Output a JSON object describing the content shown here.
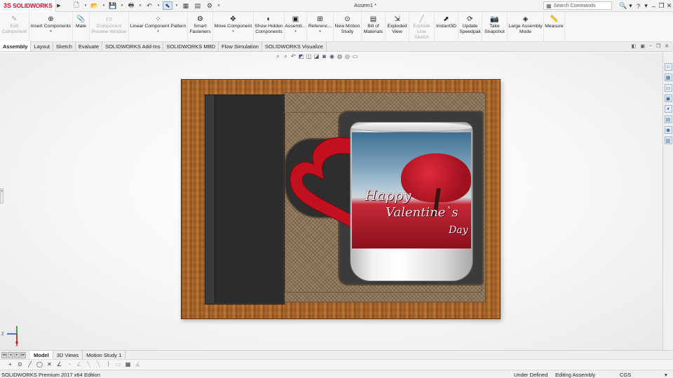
{
  "app": {
    "brand_prefix": "3S",
    "brand_name": "SOLIDWORKS",
    "document_title": "Assem1 *",
    "search_placeholder": "Search Commands"
  },
  "quick_access": [
    "new-icon",
    "open-icon",
    "save-icon",
    "print-icon",
    "undo-icon",
    "select-icon",
    "rebuild-icon",
    "file-properties-icon",
    "options-icon"
  ],
  "command_manager": [
    {
      "label": "Edit\nComponent",
      "enabled": false,
      "icon": "✎",
      "dropdown": false
    },
    {
      "label": "Insert Components",
      "enabled": true,
      "icon": "⊕",
      "dropdown": true
    },
    {
      "label": "Mate",
      "enabled": true,
      "icon": "📎",
      "dropdown": false
    },
    {
      "label": "Component\nPreview Window",
      "enabled": false,
      "icon": "▭",
      "dropdown": false
    },
    {
      "label": "Linear Component Pattern",
      "enabled": true,
      "icon": "⁘",
      "dropdown": true
    },
    {
      "label": "Smart\nFasteners",
      "enabled": true,
      "icon": "⚙",
      "dropdown": false
    },
    {
      "label": "Move Component",
      "enabled": true,
      "icon": "✥",
      "dropdown": true
    },
    {
      "label": "Show Hidden\nComponents",
      "enabled": true,
      "icon": "◐",
      "dropdown": false
    },
    {
      "label": "Assemb...",
      "enabled": true,
      "icon": "▣",
      "dropdown": true
    },
    {
      "label": "Referenc...",
      "enabled": true,
      "icon": "⊞",
      "dropdown": true
    },
    {
      "label": "New Motion\nStudy",
      "enabled": true,
      "icon": "⊙",
      "dropdown": false
    },
    {
      "label": "Bill of\nMaterials",
      "enabled": true,
      "icon": "▤",
      "dropdown": false
    },
    {
      "label": "Exploded\nView",
      "enabled": true,
      "icon": "⇲",
      "dropdown": false
    },
    {
      "label": "Explode\nLine Sketch",
      "enabled": false,
      "icon": "╱",
      "dropdown": false
    },
    {
      "label": "Instant3D",
      "enabled": true,
      "icon": "⬈",
      "dropdown": false
    },
    {
      "label": "Update\nSpeedpak",
      "enabled": true,
      "icon": "⟳",
      "dropdown": false
    },
    {
      "label": "Take\nSnapshot",
      "enabled": true,
      "icon": "📷",
      "dropdown": false
    },
    {
      "label": "Large Assembly\nMode",
      "enabled": true,
      "icon": "◈",
      "dropdown": false
    },
    {
      "label": "Measure",
      "enabled": true,
      "icon": "📏",
      "dropdown": false
    }
  ],
  "tabs": [
    "Assembly",
    "Layout",
    "Sketch",
    "Evaluate",
    "SOLIDWORKS Add-Ins",
    "SOLIDWORKS MBD",
    "Flow Simulation",
    "SOLIDWORKS Visualize"
  ],
  "active_tab": "Assembly",
  "mug": {
    "text_line1": "Happy",
    "text_line2": "Valentine`s",
    "text_line3": "Day"
  },
  "triad": {
    "z_label": "Z",
    "x_label": "X"
  },
  "bottom_tabs": [
    "Model",
    "3D Views",
    "Motion Study 1"
  ],
  "active_bottom_tab": "Model",
  "status": {
    "product": "SOLIDWORKS Premium 2017 x64 Edition",
    "definition": "Under Defined",
    "mode": "Editing Assembly",
    "units": "CGS"
  }
}
